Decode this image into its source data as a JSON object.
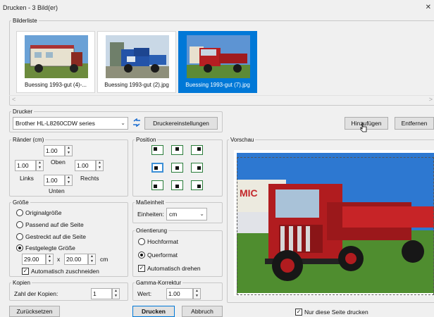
{
  "window": {
    "title": "Drucken - 3 Bild(er)",
    "close": "✕"
  },
  "image_list": {
    "legend": "Bilderliste",
    "items": [
      {
        "caption": "Buessing 1993-gut (4)-...",
        "selected": false
      },
      {
        "caption": "Buessing 1993-gut (2).jpg",
        "selected": false
      },
      {
        "caption": "Buessing 1993-gut (7).jpg",
        "selected": true
      }
    ],
    "scroll_left": "<",
    "scroll_right": ">"
  },
  "printer": {
    "legend": "Drucker",
    "selected": "Brother HL-L8260CDW series",
    "settings_button": "Druckereinstellungen"
  },
  "list_actions": {
    "add": "Hinzufügen",
    "remove": "Entfernen"
  },
  "margins": {
    "legend": "Ränder (cm)",
    "top_value": "1.00",
    "top_label": "Oben",
    "left_value": "1.00",
    "left_label": "Links",
    "right_value": "1.00",
    "right_label": "Rechts",
    "bottom_value": "1.00",
    "bottom_label": "Unten"
  },
  "position": {
    "legend": "Position",
    "selected": "middle-left"
  },
  "preview": {
    "legend": "Vorschau"
  },
  "size": {
    "legend": "Größe",
    "options": [
      "Originalgröße",
      "Passend auf die Seite",
      "Gestreckt auf die Seite",
      "Festgelegte Größe"
    ],
    "selected_index": 3,
    "width": "29.00",
    "times": "x",
    "height": "20.00",
    "unit": "cm",
    "auto_crop": "Automatisch zuschneiden",
    "auto_crop_checked": true
  },
  "unit": {
    "legend": "Maßeinheit",
    "label": "Einheiten:",
    "value": "cm"
  },
  "orientation": {
    "legend": "Orientierung",
    "portrait": "Hochformat",
    "landscape": "Querformat",
    "selected": "Querformat",
    "auto_rotate": "Automatisch drehen",
    "auto_rotate_checked": true
  },
  "copies": {
    "legend": "Kopien",
    "label": "Zahl der Kopien:",
    "value": "1"
  },
  "gamma": {
    "legend": "Gamma-Korrektur",
    "label": "Wert:",
    "value": "1.00"
  },
  "footer": {
    "reset": "Zurücksetzen",
    "print": "Drucken",
    "cancel": "Abbruch",
    "only_this_page": "Nur diese Seite drucken",
    "only_this_page_checked": true
  },
  "icons": {
    "refresh": "refresh-icon",
    "spin_up": "▲",
    "spin_down": "▼",
    "dropdown": "⌄",
    "check": "✓"
  }
}
